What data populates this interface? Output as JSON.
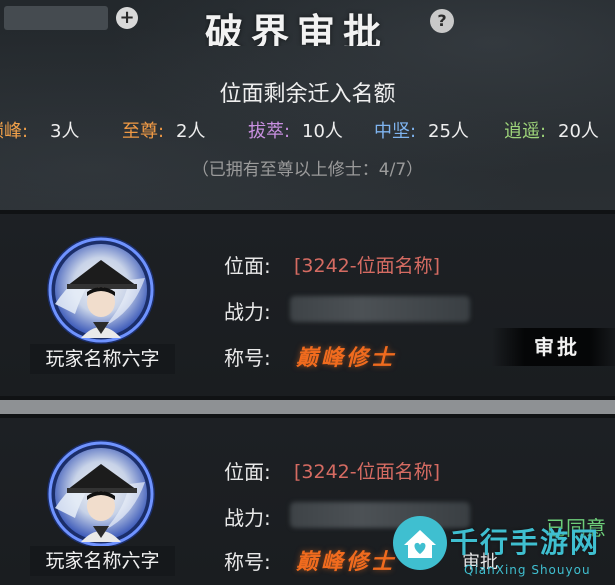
{
  "header": {
    "title": "破界审批",
    "plus_label": "+",
    "help_label": "?"
  },
  "quota": {
    "title": "位面剩余迁入名额",
    "items": [
      {
        "label": "巅峰:",
        "value": "3人"
      },
      {
        "label": "至尊:",
        "value": "2人"
      },
      {
        "label": "拔萃:",
        "value": "10人"
      },
      {
        "label": "中坚:",
        "value": "25人"
      },
      {
        "label": "逍遥:",
        "value": "20人"
      }
    ],
    "note": "（已拥有至尊以上修士：4/7）"
  },
  "labels": {
    "plane": "位面:",
    "power": "战力:",
    "title": "称号:"
  },
  "applicants": [
    {
      "name": "玩家名称六字",
      "plane": "[3242-位面名称]",
      "title": "巅峰修士",
      "action": "审批"
    },
    {
      "name": "玩家名称六字",
      "plane": "[3242-位面名称]",
      "title": "巅峰修士",
      "status": "已同意",
      "action": "审批"
    }
  ],
  "watermark": {
    "brand": "千行手游网",
    "url": "QianXing Shouyou"
  },
  "colors": {
    "peak": "#f0a04a",
    "elite": "#c890e0",
    "core": "#7fb4f0",
    "free": "#9ed57a",
    "plane_text": "#d56b62",
    "title_text": "#f06b1e",
    "agreed": "#6ecf7a"
  }
}
